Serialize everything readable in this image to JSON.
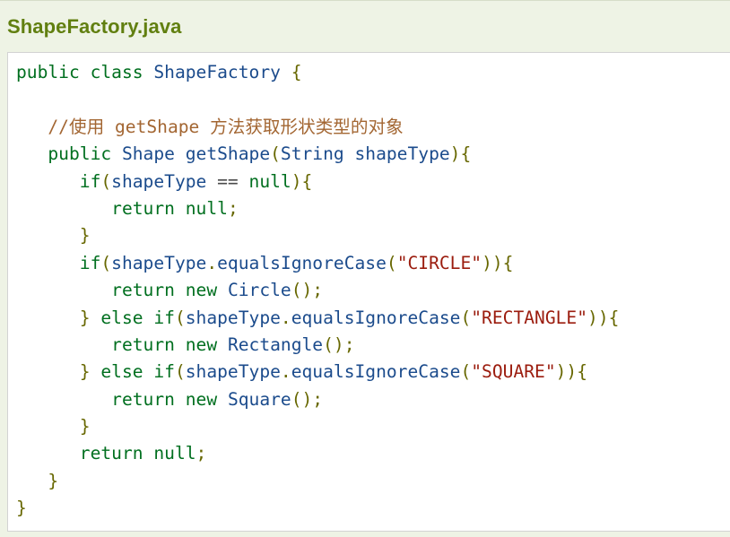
{
  "file": {
    "title": "ShapeFactory.java"
  },
  "code": {
    "line1": {
      "k1": "public",
      "k2": "class",
      "t1": "ShapeFactory",
      "p1": "{"
    },
    "line3": {
      "comment": "//使用 getShape 方法获取形状类型的对象"
    },
    "line4": {
      "k1": "public",
      "t1": "Shape",
      "t2": "getShape",
      "p1": "(",
      "t3": "String",
      "t4": "shapeType",
      "p2": "){"
    },
    "line5": {
      "k1": "if",
      "p1": "(",
      "t1": "shapeType",
      "op": "==",
      "k2": "null",
      "p2": "){"
    },
    "line6": {
      "k1": "return",
      "k2": "null",
      "p1": ";"
    },
    "line7": {
      "p1": "}"
    },
    "line8": {
      "k1": "if",
      "p1": "(",
      "t1": "shapeType",
      "p2": ".",
      "t2": "equalsIgnoreCase",
      "p3": "(",
      "s1": "\"CIRCLE\"",
      "p4": ")){"
    },
    "line9": {
      "k1": "return",
      "k2": "new",
      "t1": "Circle",
      "p1": "();"
    },
    "line10": {
      "p1": "}",
      "k1": "else",
      "k2": "if",
      "p2": "(",
      "t1": "shapeType",
      "p3": ".",
      "t2": "equalsIgnoreCase",
      "p4": "(",
      "s1": "\"RECTANGLE\"",
      "p5": ")){"
    },
    "line11": {
      "k1": "return",
      "k2": "new",
      "t1": "Rectangle",
      "p1": "();"
    },
    "line12": {
      "p1": "}",
      "k1": "else",
      "k2": "if",
      "p2": "(",
      "t1": "shapeType",
      "p3": ".",
      "t2": "equalsIgnoreCase",
      "p4": "(",
      "s1": "\"SQUARE\"",
      "p5": ")){"
    },
    "line13": {
      "k1": "return",
      "k2": "new",
      "t1": "Square",
      "p1": "();"
    },
    "line14": {
      "p1": "}"
    },
    "line15": {
      "k1": "return",
      "k2": "null",
      "p1": ";"
    },
    "line16": {
      "p1": "}"
    },
    "line17": {
      "p1": "}"
    }
  },
  "colors": {
    "title": "#617f10",
    "keyword": "#006f1f",
    "type": "#1b4b8c",
    "string": "#9b1c0e",
    "punctuation": "#676700",
    "comment": "#a36632"
  }
}
